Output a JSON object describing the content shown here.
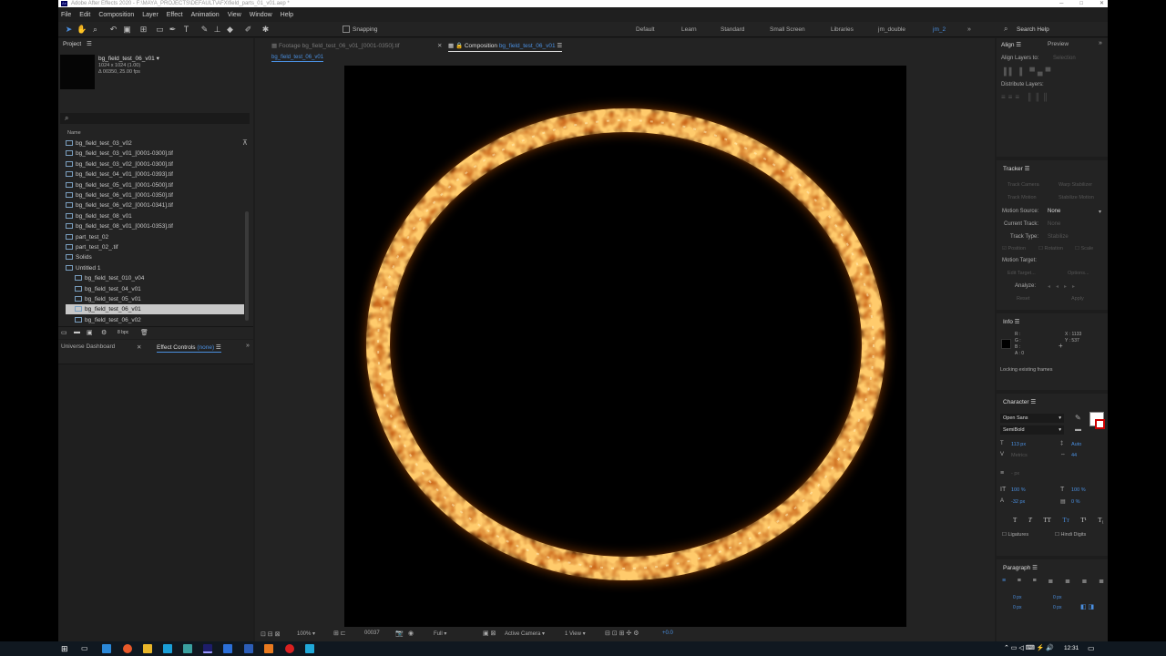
{
  "titlebar": {
    "text": "Adobe After Effects 2020 - F:\\MAYA_PROJECTS\\DEFAULT\\AFX\\field_parts_01_v01.aep *"
  },
  "menu": [
    "File",
    "Edit",
    "Composition",
    "Layer",
    "Effect",
    "Animation",
    "View",
    "Window",
    "Help"
  ],
  "toolbar": {
    "snapping": "Snapping"
  },
  "workspaces": [
    "Default",
    "Learn",
    "Standard",
    "Small Screen",
    "Libraries",
    "jm_double",
    "jm_2"
  ],
  "search_help": "Search Help",
  "project": {
    "title": "Project",
    "comp_name": "bg_field_test_06_v01 ▾",
    "comp_size": "1024 x 1024 (1.00)",
    "comp_duration": "Δ 00350, 25.00 fps",
    "column_name": "Name",
    "items": [
      {
        "label": "bg_field_test_03_v02",
        "indent": 0,
        "selected": false
      },
      {
        "label": "bg_field_test_03_v01_[0001-0300].tif",
        "indent": 0,
        "selected": false
      },
      {
        "label": "bg_field_test_03_v02_[0001-0300].tif",
        "indent": 0,
        "selected": false
      },
      {
        "label": "bg_field_test_04_v01_[0001-0393].tif",
        "indent": 0,
        "selected": false
      },
      {
        "label": "bg_field_test_05_v01_[0001-0500].tif",
        "indent": 0,
        "selected": false
      },
      {
        "label": "bg_field_test_06_v01_[0001-0350].tif",
        "indent": 0,
        "selected": false
      },
      {
        "label": "bg_field_test_06_v02_[0001-0341].tif",
        "indent": 0,
        "selected": false
      },
      {
        "label": "bg_field_test_08_v01",
        "indent": 0,
        "selected": false
      },
      {
        "label": "bg_field_test_08_v01_[0001-0353].tif",
        "indent": 0,
        "selected": false
      },
      {
        "label": "part_test_02",
        "indent": 0,
        "selected": false
      },
      {
        "label": "part_test_02_.tif",
        "indent": 0,
        "selected": false
      },
      {
        "label": "Solids",
        "indent": 0,
        "selected": false
      },
      {
        "label": "Untitled 1",
        "indent": 0,
        "selected": false
      },
      {
        "label": "bg_field_test_010_v04",
        "indent": 1,
        "selected": false
      },
      {
        "label": "bg_field_test_04_v01",
        "indent": 1,
        "selected": false
      },
      {
        "label": "bg_field_test_05_v01",
        "indent": 1,
        "selected": false
      },
      {
        "label": "bg_field_test_06_v01",
        "indent": 1,
        "selected": true
      },
      {
        "label": "bg_field_test_06_v02",
        "indent": 1,
        "selected": false
      }
    ],
    "bpc": "8 bpc"
  },
  "lower_left": {
    "tab1": "Universe Dashboard",
    "tab2": "Effect Controls",
    "tab2_suffix": "(none)"
  },
  "viewer": {
    "footage_tab": "Footage",
    "footage_name": "bg_field_test_06_v01_[0001-0350].tif",
    "comp_tab": "Composition",
    "comp_name": "bg_field_test_06_v01",
    "sub_tab": "bg_field_test_06_v01",
    "zoom": "100%",
    "timecode": "00037",
    "resolution": "Full",
    "camera": "Active Camera",
    "views": "1 View",
    "exposure": "+0.0"
  },
  "align": {
    "tab": "Align",
    "tab2": "Preview",
    "align_to": "Align Layers to:",
    "align_to_value": "Selection",
    "distribute": "Distribute Layers:"
  },
  "tracker": {
    "title": "Tracker",
    "motion_source": "Motion Source:",
    "motion_source_value": "None",
    "current_track": "Current Track:",
    "current_track_value": "None",
    "track_type": "Track Type:",
    "track_type_value": "Stabilize",
    "motion_target": "Motion Target:",
    "analyze": "Analyze:",
    "btn_track_camera": "Track Camera",
    "btn_warp": "Warp Stabilizer",
    "btn_track_motion": "Track Motion",
    "btn_stabilize": "Stabilize Motion",
    "btn_edit_target": "Edit Target...",
    "btn_options": "Options...",
    "btn_reset": "Reset",
    "btn_apply": "Apply",
    "chk_position": "Position",
    "chk_rotation": "Rotation",
    "chk_scale": "Scale"
  },
  "info": {
    "title": "Info",
    "r": "R :",
    "g": "G :",
    "b": "B :",
    "a": "A : 0",
    "x": "X : 1133",
    "y": "Y : 537",
    "status": "Locking existing frames"
  },
  "character": {
    "title": "Character",
    "font": "Open Sans",
    "style": "SemiBold",
    "size": "113 px",
    "leading": "Auto",
    "kerning": "Metrics",
    "tracking": "44",
    "stroke": "- px",
    "vscale": "100 %",
    "hscale": "100 %",
    "baseline": "-32 px",
    "tsume": "0 %",
    "ligatures": "Ligatures",
    "hindi": "Hindi Digits",
    "styles": [
      "T",
      "T",
      "TT",
      "Tт",
      "T¹",
      "T₁"
    ]
  },
  "paragraph": {
    "title": "Paragraph",
    "v1": "0 px",
    "v2": "0 px",
    "v3": "0 px",
    "v4": "0 px",
    "v5": "0 px"
  },
  "clock": "12:31",
  "colors": {
    "accent": "#4a8fe0",
    "ring_core": "#ffd27a",
    "ring_outer": "#ff8a2a",
    "ring_glow": "#ff6a00"
  }
}
